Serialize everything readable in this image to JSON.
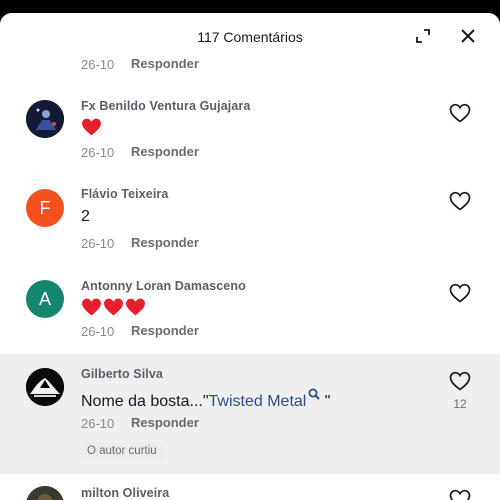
{
  "header": {
    "title": "117 Comentários"
  },
  "comments": [
    {
      "date": "26-10",
      "reply_label": "Responder"
    },
    {
      "username": "Fx Benildo Ventura Gujajara",
      "text_emoji": "❤️",
      "date": "26-10",
      "reply_label": "Responder"
    },
    {
      "username": "Flávio Teixeira",
      "avatar_letter": "F",
      "avatar_color": "#f4511e",
      "text": "2",
      "date": "26-10",
      "reply_label": "Responder"
    },
    {
      "username": "Antonny Loran Damasceno",
      "avatar_letter": "A",
      "avatar_color": "#14866d",
      "text_emoji": "❤️❤️❤️",
      "date": "26-10",
      "reply_label": "Responder"
    },
    {
      "username": "Gilberto Silva",
      "text_prefix": "Nome da bosta...\"",
      "link_text": "Twisted Metal",
      "text_suffix": " \"",
      "date": "26-10",
      "reply_label": "Responder",
      "like_count": "12",
      "badge": "O autor curtiu"
    },
    {
      "username": "milton Oliveira"
    }
  ],
  "colors": {
    "highlight_bg": "#efeff0",
    "link": "#2c4f8c",
    "heart_red": "#e5202c"
  }
}
